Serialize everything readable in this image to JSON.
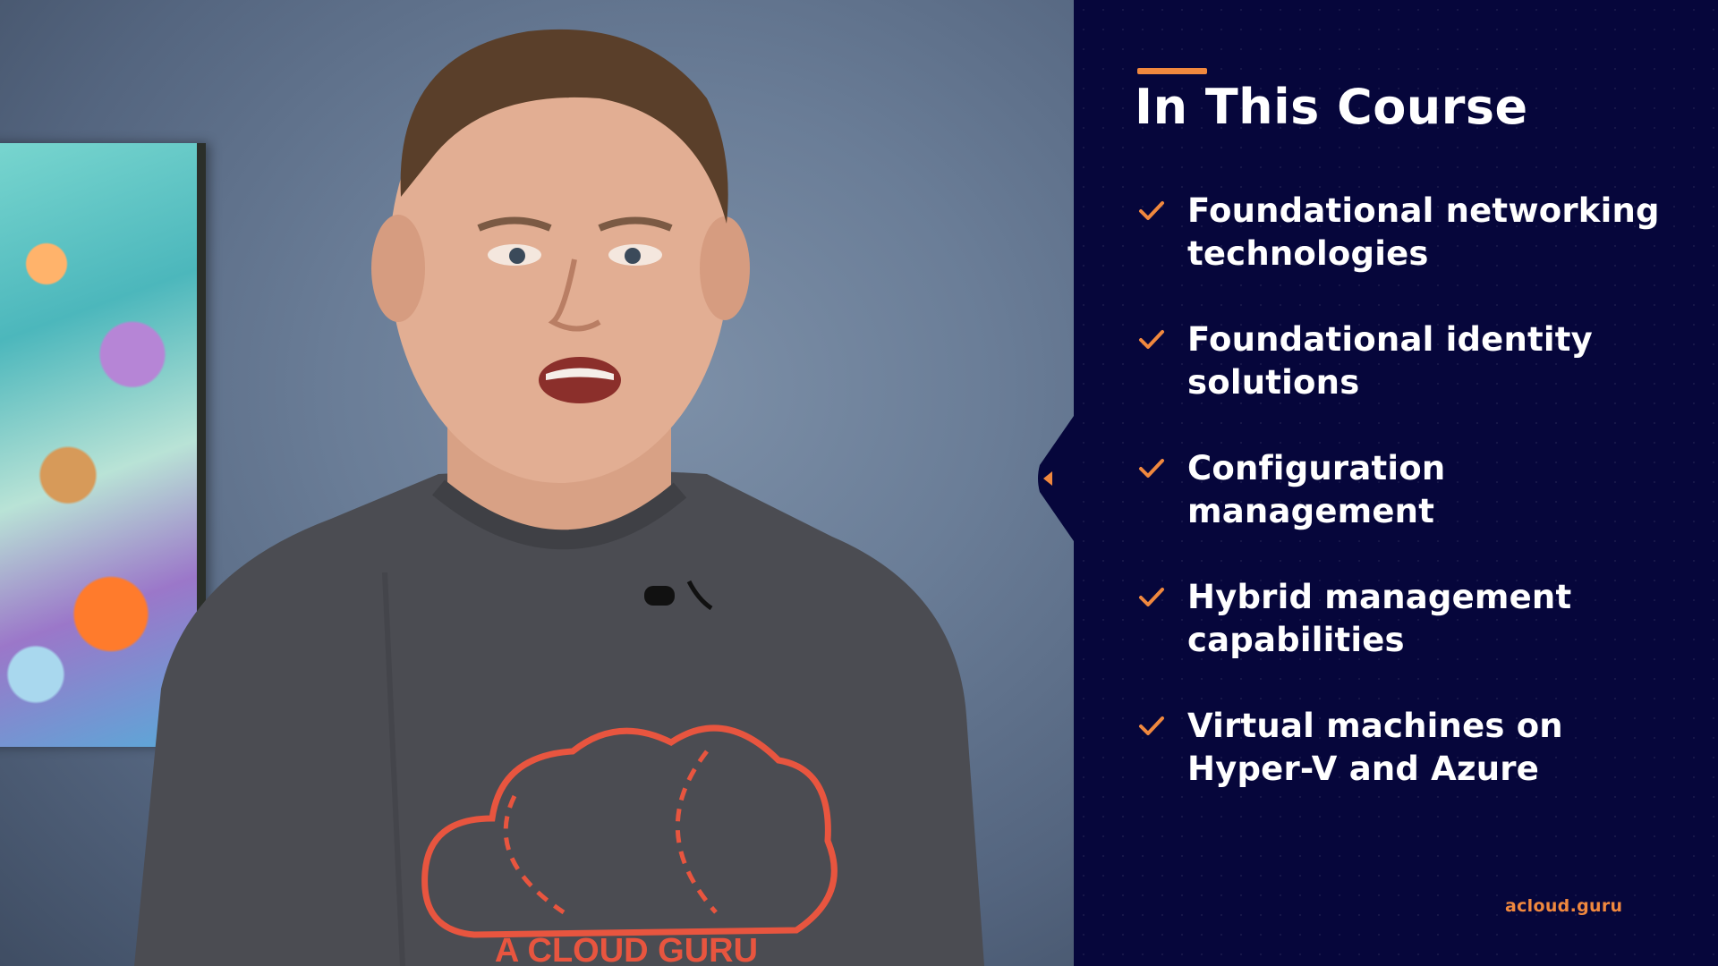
{
  "slide": {
    "title": "In This Course",
    "items": [
      {
        "label": "Foundational networking technologies"
      },
      {
        "label": "Foundational identity solutions"
      },
      {
        "label": "Configuration management"
      },
      {
        "label": "Hybrid management capabilities"
      },
      {
        "label": "Virtual machines on Hyper-V and Azure"
      }
    ],
    "brand": "acloud.guru"
  },
  "video": {
    "shirt_text": "A CLOUD GURU"
  },
  "colors": {
    "panel_background": "#06063b",
    "accent": "#f0883e",
    "text": "#ffffff",
    "wall": "#6a7d97",
    "shirt": "#4b4c52",
    "shirt_logo": "#e8553f"
  },
  "icons": {
    "item_icon": "checkmark-icon",
    "panel_edge_icon": "caret-left-icon"
  }
}
